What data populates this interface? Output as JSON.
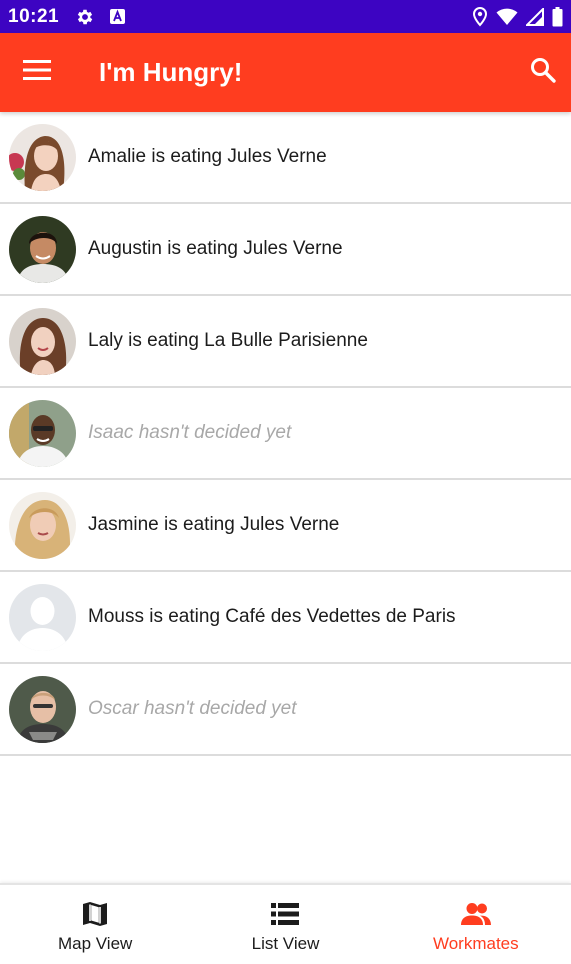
{
  "status_bar": {
    "time": "10:21",
    "left_icons": [
      "settings-icon",
      "a-badge-icon"
    ],
    "right_icons": [
      "location-icon",
      "wifi-icon",
      "signal-icon",
      "battery-icon"
    ],
    "background": "#3d04c2"
  },
  "app_bar": {
    "title": "I'm Hungry!",
    "menu_icon": "menu-icon",
    "search_icon": "search-icon",
    "background": "#ff3d1f"
  },
  "workmates": [
    {
      "text": "Amalie is eating Jules Verne",
      "decided": true,
      "avatar": "photo"
    },
    {
      "text": "Augustin is eating Jules Verne",
      "decided": true,
      "avatar": "photo"
    },
    {
      "text": "Laly is eating La Bulle Parisienne",
      "decided": true,
      "avatar": "photo"
    },
    {
      "text": "Isaac hasn't decided yet",
      "decided": false,
      "avatar": "photo"
    },
    {
      "text": "Jasmine is eating Jules Verne",
      "decided": true,
      "avatar": "photo"
    },
    {
      "text": "Mouss is eating Café des Vedettes de Paris",
      "decided": true,
      "avatar": "placeholder"
    },
    {
      "text": "Oscar hasn't decided yet",
      "decided": false,
      "avatar": "photo"
    }
  ],
  "bottom_nav": {
    "items": [
      {
        "label": "Map View",
        "icon": "map-icon",
        "active": false
      },
      {
        "label": "List View",
        "icon": "list-icon",
        "active": false
      },
      {
        "label": "Workmates",
        "icon": "people-icon",
        "active": true
      }
    ],
    "active_color": "#ff3d1f"
  }
}
